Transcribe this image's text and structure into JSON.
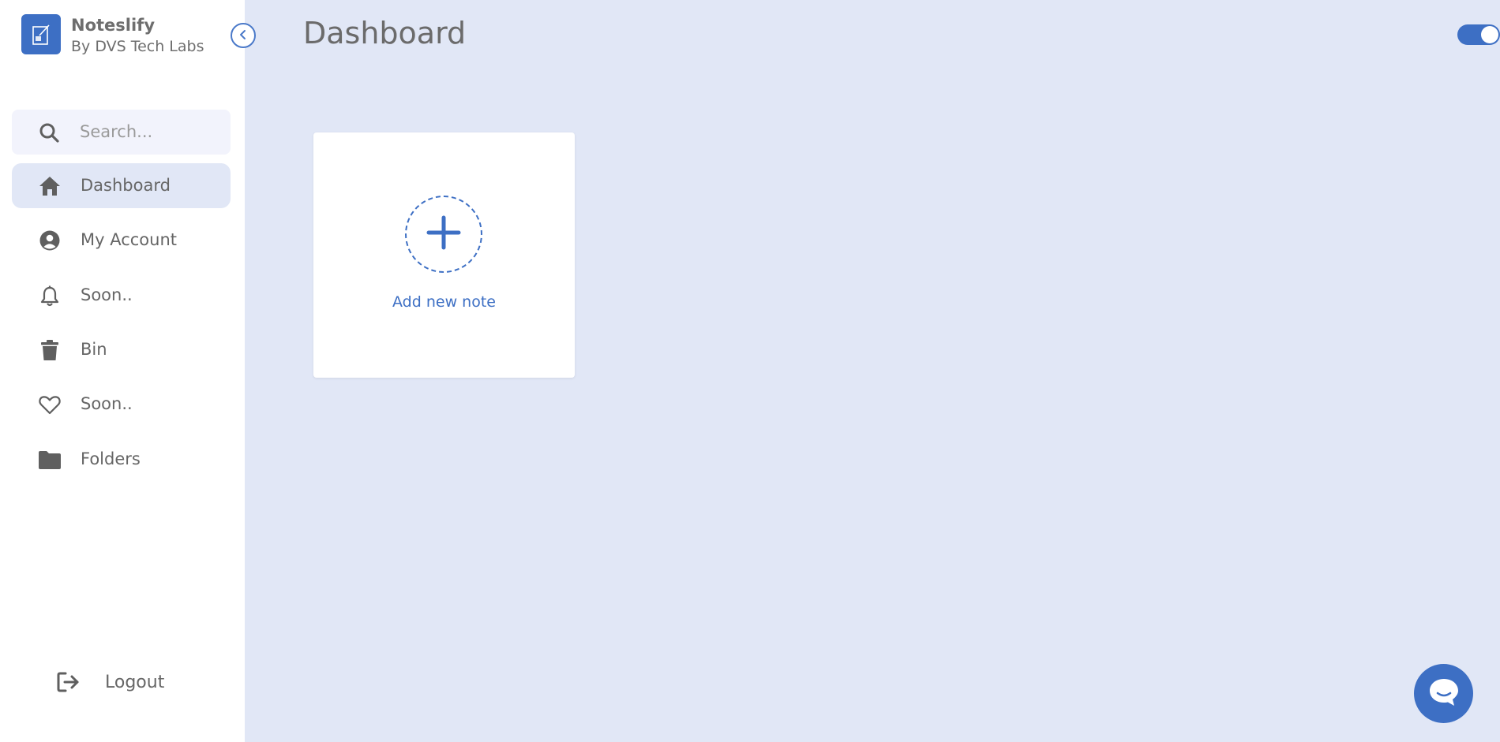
{
  "brand": {
    "name": "Noteslify",
    "subtitle": "By DVS Tech Labs",
    "logo_icon": "note-pencil-icon",
    "color": "#3d6fc4"
  },
  "sidebar": {
    "search": {
      "placeholder": "Search...",
      "value": "",
      "icon": "search-icon"
    },
    "items": [
      {
        "label": "Dashboard",
        "icon": "home-icon",
        "active": true
      },
      {
        "label": "My Account",
        "icon": "user-circle-icon",
        "active": false
      },
      {
        "label": "Soon..",
        "icon": "bell-icon",
        "active": false
      },
      {
        "label": "Bin",
        "icon": "trash-icon",
        "active": false
      },
      {
        "label": "Soon..",
        "icon": "heart-icon",
        "active": false
      },
      {
        "label": "Folders",
        "icon": "folder-icon",
        "active": false
      }
    ],
    "logout": {
      "label": "Logout",
      "icon": "logout-icon"
    }
  },
  "main": {
    "title": "Dashboard",
    "add_note": {
      "label": "Add new note",
      "icon": "plus-icon"
    },
    "theme_toggle": {
      "on": true
    }
  },
  "colors": {
    "accent": "#3d6fc4",
    "background": "#e1e7f6",
    "sidebar": "#ffffff",
    "text": "#666666"
  }
}
